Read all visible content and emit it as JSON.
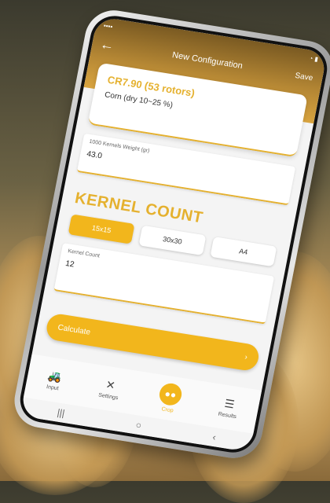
{
  "appbar": {
    "title": "New Configuration",
    "save_label": "Save"
  },
  "config": {
    "main": "CR7.90 (53 rotors)",
    "sub": "Corn (dry 10~25 %)"
  },
  "weight_field": {
    "label": "1000 Kernels Weight (gr)",
    "value": "43.0"
  },
  "section_heading": "KERNEL COUNT",
  "tabs": [
    {
      "label": "15x15"
    },
    {
      "label": "30x30"
    },
    {
      "label": "A4"
    }
  ],
  "count_field": {
    "label": "Kernel Count",
    "value": "12"
  },
  "calculate": {
    "label": "Calculate",
    "arrow": "›"
  },
  "bottom_nav": [
    {
      "label": "Input"
    },
    {
      "label": "Settings"
    },
    {
      "label": "Crop"
    },
    {
      "label": "Results"
    }
  ],
  "system_nav": {
    "recent": "|||",
    "home": "○",
    "back": "‹"
  }
}
